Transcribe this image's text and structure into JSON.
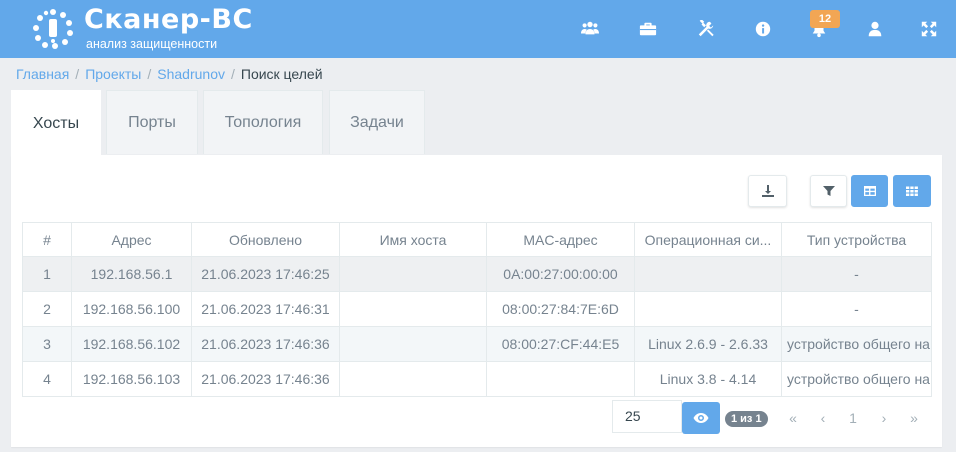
{
  "brand": {
    "title": "Сканер-ВС",
    "subtitle": "анализ защищенности"
  },
  "header": {
    "icons": [
      "users-icon",
      "briefcase-icon",
      "tools-icon",
      "info-icon",
      "bell-icon",
      "user-icon",
      "fullscreen-icon"
    ],
    "notifications_count": "12"
  },
  "breadcrumb": {
    "items": [
      "Главная",
      "Проекты",
      "Shadrunov"
    ],
    "current": "Поиск целей",
    "separator": "/"
  },
  "tabs": [
    {
      "label": "Хосты",
      "active": true
    },
    {
      "label": "Порты",
      "active": false
    },
    {
      "label": "Топология",
      "active": false
    },
    {
      "label": "Задачи",
      "active": false
    }
  ],
  "table": {
    "columns": [
      "#",
      "Адрес",
      "Обновлено",
      "Имя хоста",
      "MAC-адрес",
      "Операционная си...",
      "Тип устройства"
    ],
    "rows": [
      [
        "1",
        "192.168.56.1",
        "21.06.2023 17:46:25",
        "",
        "0A:00:27:00:00:00",
        "",
        "-"
      ],
      [
        "2",
        "192.168.56.100",
        "21.06.2023 17:46:31",
        "",
        "08:00:27:84:7E:6D",
        "",
        "-"
      ],
      [
        "3",
        "192.168.56.102",
        "21.06.2023 17:46:36",
        "",
        "08:00:27:CF:44:E5",
        "Linux 2.6.9 - 2.6.33",
        "устройство общего на"
      ],
      [
        "4",
        "192.168.56.103",
        "21.06.2023 17:46:36",
        "",
        "",
        "Linux 3.8 - 4.14",
        "устройство общего на"
      ]
    ]
  },
  "pagination": {
    "page_size": "25",
    "count_label": "1 из 1",
    "first": "«",
    "prev": "‹",
    "current_page": "1",
    "next": "›",
    "last": "»"
  },
  "colors": {
    "header": "#62a8ea",
    "accent": "#62a8ea",
    "badge": "#f2a654"
  }
}
